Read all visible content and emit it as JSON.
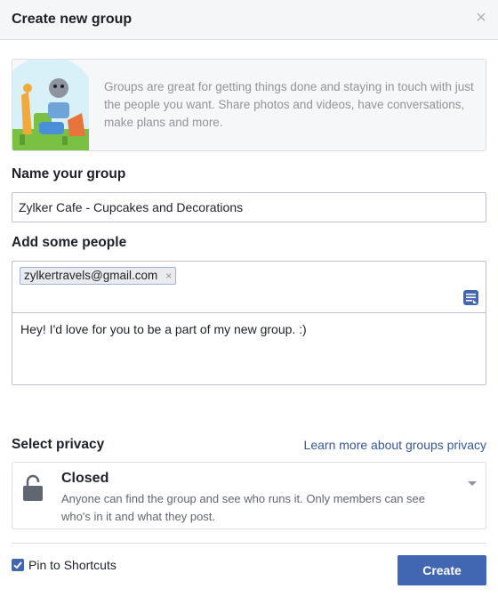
{
  "header": {
    "title": "Create new group",
    "close_icon": "close-icon"
  },
  "intro": {
    "text": "Groups are great for getting things done and staying in touch with just the people you want. Share photos and videos, have conversations, make plans and more."
  },
  "name_section": {
    "label": "Name your group",
    "value": "Zylker Cafe - Cupcakes and Decorations"
  },
  "people_section": {
    "label": "Add some people",
    "tokens": [
      "zylkertravels@gmail.com"
    ],
    "message": "Hey! I'd love for you to be a part of my new group. :)"
  },
  "privacy_section": {
    "label": "Select privacy",
    "link": "Learn more about groups privacy",
    "selected_title": "Closed",
    "selected_desc": "Anyone can find the group and see who runs it. Only members can see who's in it and what they post."
  },
  "footer": {
    "pin_label": "Pin to Shortcuts",
    "pin_checked": true,
    "create_label": "Create"
  },
  "colors": {
    "accent": "#4267b2",
    "link": "#365899",
    "header_bg": "#f5f6f7"
  }
}
